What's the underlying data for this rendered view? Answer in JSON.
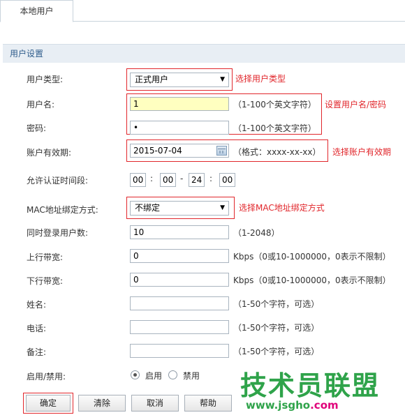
{
  "tab": {
    "label": "本地用户"
  },
  "section": {
    "title": "用户设置"
  },
  "user_type": {
    "label": "用户类型:",
    "value": "正式用户",
    "annotation": "选择用户类型"
  },
  "username": {
    "label": "用户名:",
    "value": "1",
    "hint": "（1-100个英文字符）"
  },
  "password": {
    "label": "密码:",
    "value": "•",
    "hint": "（1-100个英文字符）"
  },
  "credentials_annotation": "设置用户名/密码",
  "expiry": {
    "label": "账户有效期:",
    "value": "2015-07-04",
    "hint": "（格式：xxxx-xx-xx）",
    "annotation": "选择账户有效期"
  },
  "auth_time": {
    "label": "允许认证时间段:",
    "start_hour": "00",
    "start_minute": "00",
    "end_hour": "24",
    "end_minute": "00",
    "colon": ":",
    "dash": "-"
  },
  "mac_binding": {
    "label": "MAC地址绑定方式:",
    "value": "不绑定",
    "annotation": "选择MAC地址绑定方式"
  },
  "concurrent_users": {
    "label": "同时登录用户数:",
    "value": "10",
    "hint": "（1-2048）"
  },
  "upstream": {
    "label": "上行带宽:",
    "value": "0",
    "hint": "Kbps（0或10-1000000，0表示不限制）"
  },
  "downstream": {
    "label": "下行带宽:",
    "value": "0",
    "hint": "Kbps（0或10-1000000，0表示不限制）"
  },
  "name": {
    "label": "姓名:",
    "value": "",
    "hint": "（1-50个字符，可选）"
  },
  "phone": {
    "label": "电话:",
    "value": "",
    "hint": "（1-50个字符，可选）"
  },
  "note": {
    "label": "备注:",
    "value": "",
    "hint": "（1-50个字符，可选）"
  },
  "status": {
    "label": "启用/禁用:",
    "enable_label": "启用",
    "disable_label": "禁用",
    "selected": "启用"
  },
  "buttons": {
    "confirm": "确定",
    "clear": "清除",
    "cancel": "取消",
    "help": "帮助"
  },
  "watermark": {
    "title": "技术员联盟",
    "domain": "www.jsgho",
    "domain_suffix": ".com"
  },
  "colors": {
    "annotation": "#e1262b",
    "section_bg": "#e8eef4",
    "section_text": "#2f5d8c",
    "highlight_input": "#ffffc0",
    "watermark_green": "#2fa34a"
  }
}
